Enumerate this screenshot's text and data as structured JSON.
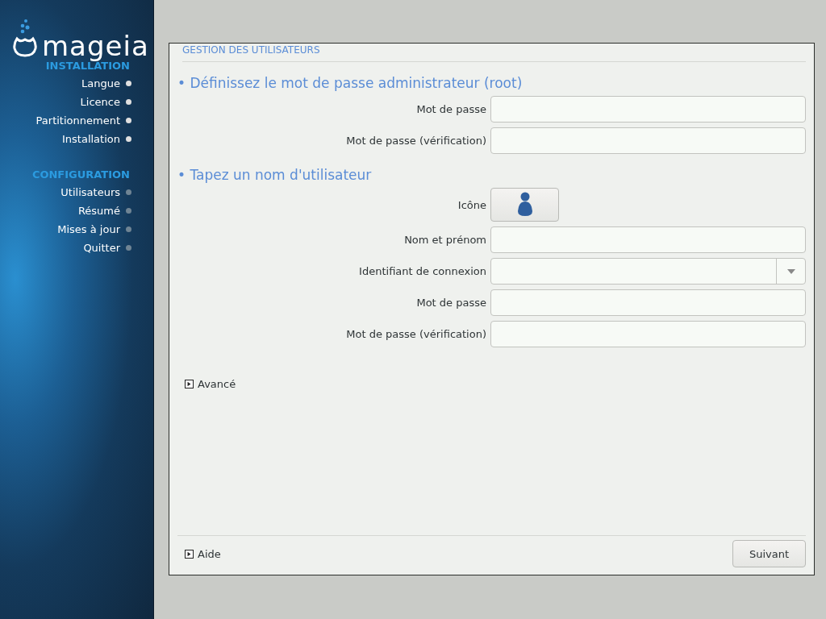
{
  "sidebar": {
    "logo": "mageia",
    "groups": [
      {
        "heading": "INSTALLATION",
        "items": [
          {
            "label": "Langue",
            "done": true
          },
          {
            "label": "Licence",
            "done": true
          },
          {
            "label": "Partitionnement",
            "done": true
          },
          {
            "label": "Installation",
            "done": true
          }
        ]
      },
      {
        "heading": "CONFIGURATION",
        "items": [
          {
            "label": "Utilisateurs",
            "done": false
          },
          {
            "label": "Résumé",
            "done": false
          },
          {
            "label": "Mises à jour",
            "done": false
          },
          {
            "label": "Quitter",
            "done": false
          }
        ]
      }
    ]
  },
  "panel": {
    "title": "GESTION DES UTILISATEURS",
    "sections": [
      {
        "heading": "• Définissez le mot de passe administrateur (root)",
        "fields": [
          {
            "kind": "text",
            "label": "Mot de passe"
          },
          {
            "kind": "text",
            "label": "Mot de passe (vérification)"
          }
        ]
      },
      {
        "heading": "• Tapez un nom d'utilisateur",
        "fields": [
          {
            "kind": "icon",
            "label": "Icône"
          },
          {
            "kind": "text",
            "label": "Nom et prénom"
          },
          {
            "kind": "combo",
            "label": "Identifiant de connexion"
          },
          {
            "kind": "text",
            "label": "Mot de passe"
          },
          {
            "kind": "text",
            "label": "Mot de passe (vérification)"
          }
        ]
      }
    ],
    "advanced": {
      "label": "Avancé",
      "expanded": false
    },
    "help": {
      "label": "Aide",
      "expanded": false
    },
    "next_button": "Suivant"
  }
}
